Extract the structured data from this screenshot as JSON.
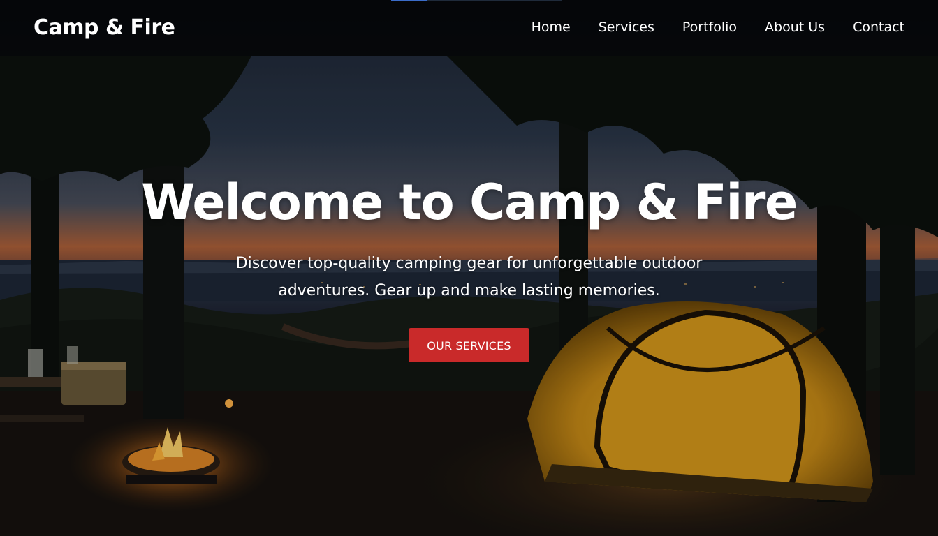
{
  "navbar": {
    "brand": "Camp & Fire",
    "links": [
      {
        "label": "Home"
      },
      {
        "label": "Services"
      },
      {
        "label": "Portfolio"
      },
      {
        "label": "About Us"
      },
      {
        "label": "Contact"
      }
    ]
  },
  "hero": {
    "title": "Welcome to Camp & Fire",
    "subtitle": "Discover top-quality camping gear for unforgettable outdoor adventures. Gear up and make lasting memories.",
    "cta_label": "OUR SERVICES",
    "background": "night campsite with glowing yellow tent, campfire and forest overlooking a lake at dusk"
  },
  "colors": {
    "navbar_bg": "#000000",
    "cta_bg": "#c92a2a",
    "text": "#ffffff",
    "tent": "#e0a020",
    "fire": "#ff9a2a",
    "sky_sunset": "#c46a3c"
  }
}
